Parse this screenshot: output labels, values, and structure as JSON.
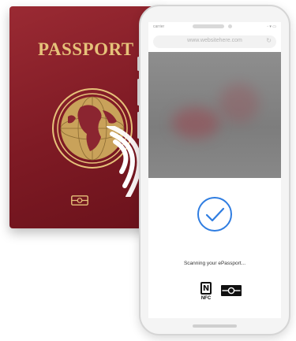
{
  "passport": {
    "title": "PASSPORT",
    "cover_color": "#7e1a24",
    "emblem_color": "#e6c27a",
    "emblem_icon": "globe-icon",
    "chip_icon": "biometric-chip-icon",
    "contactless_icon": "contactless-waves-icon"
  },
  "phone": {
    "status_bar": {
      "carrier": "carrier",
      "status_right": "◦ ▾ ▭"
    },
    "browser": {
      "url": "www.websitehere.com",
      "reload_icon": "reload-icon"
    },
    "scan_sheet": {
      "success_icon": "checkmark-circle-icon",
      "accent_color": "#2f7de1",
      "message": "Scanning your ePassport...",
      "nfc_label": "NFC",
      "nfc_glyph": "N",
      "chip_icon": "epassport-chip-icon"
    }
  }
}
